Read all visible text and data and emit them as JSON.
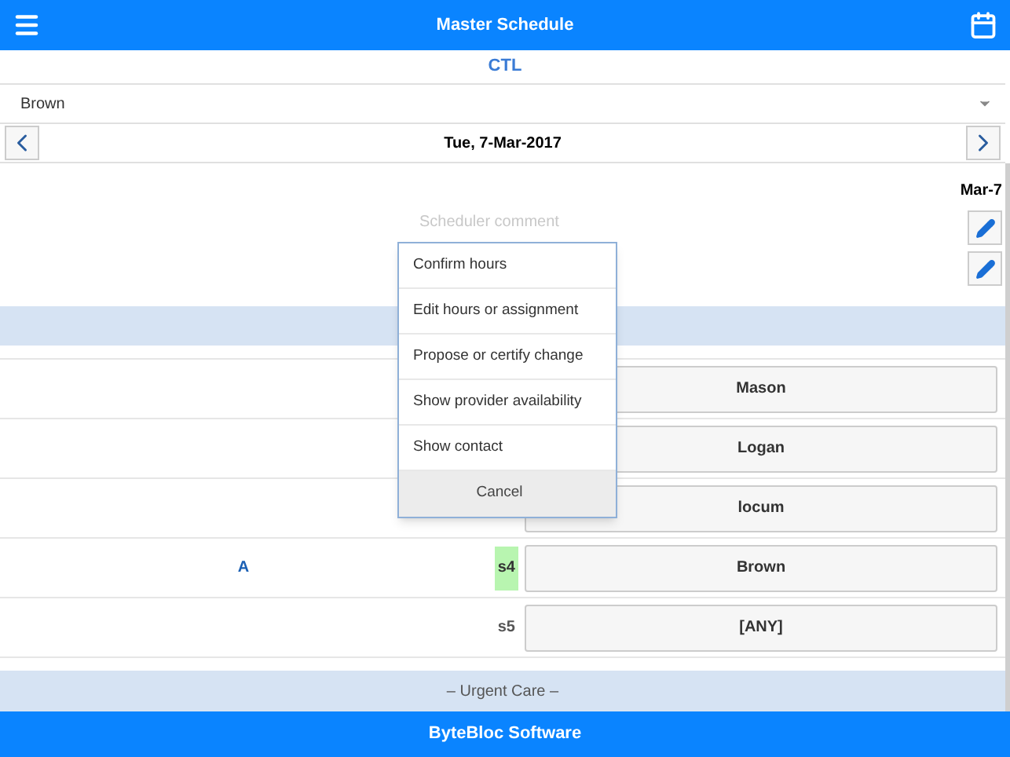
{
  "header": {
    "title": "Master Schedule"
  },
  "site": "CTL",
  "provider_select": {
    "value": "Brown"
  },
  "date_nav": {
    "date": "Tue, 7-Mar-2017"
  },
  "day": {
    "label": "Mar-7",
    "comment_placeholder": "Scheduler comment"
  },
  "rows": [
    {
      "provider": "Mason"
    },
    {
      "provider": "Logan"
    },
    {
      "provider": "locum"
    },
    {
      "team": "A",
      "slot": "s4",
      "provider": "Brown",
      "highlighted": true
    },
    {
      "slot": "s5",
      "provider": "[ANY]",
      "highlighted": false
    }
  ],
  "section": "– Urgent Care –",
  "menu": [
    {
      "label": "Confirm hours",
      "kind": "item"
    },
    {
      "label": "Edit hours or assignment",
      "kind": "item"
    },
    {
      "label": "Propose or certify change",
      "kind": "item"
    },
    {
      "label": "Show provider availability",
      "kind": "item"
    },
    {
      "label": "Show contact",
      "kind": "item"
    },
    {
      "label": "Cancel",
      "kind": "cancel"
    }
  ],
  "footer": "ByteBloc Software"
}
